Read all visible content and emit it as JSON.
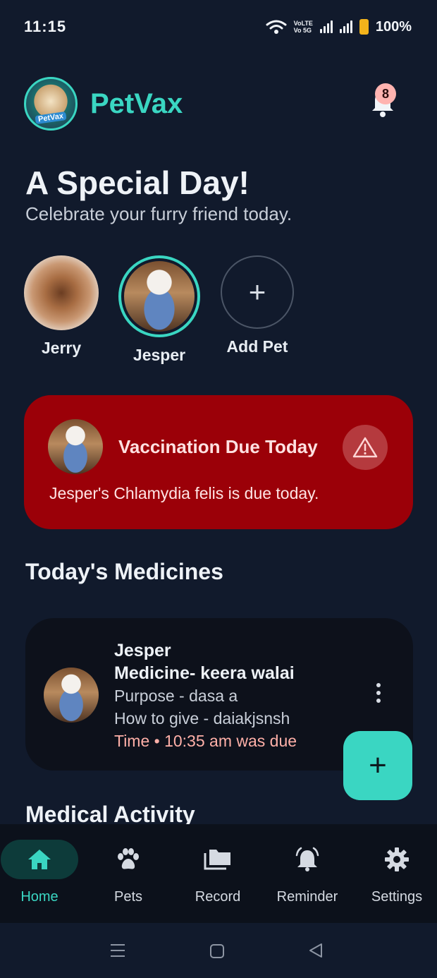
{
  "status_bar": {
    "time": "11:15",
    "volte_top": "VoLTE",
    "volte_bottom": "Vo 5G",
    "battery": "100%"
  },
  "header": {
    "app_name": "PetVax",
    "logo_text": "PetVax",
    "notification_count": "8"
  },
  "greeting": {
    "title": "A Special Day!",
    "subtitle": "Celebrate your furry friend today."
  },
  "pets": [
    {
      "name": "Jerry",
      "selected": false
    },
    {
      "name": "Jesper",
      "selected": true
    }
  ],
  "add_pet_label": "Add Pet",
  "vaccination_alert": {
    "title": "Vaccination Due Today",
    "message": "Jesper's Chlamydia felis is due today."
  },
  "medicines": {
    "section_title": "Today's Medicines",
    "item": {
      "pet": "Jesper",
      "medicine": "Medicine-  keera walai",
      "purpose": "Purpose  -  dasa a",
      "how_to_give": "How to give  -  daiakjsnsh",
      "time": "Time  •  10:35 am was due"
    }
  },
  "next_section_title": "Medical Activity",
  "fab_label": "+",
  "nav": [
    {
      "label": "Home",
      "icon": "home-icon",
      "active": true
    },
    {
      "label": "Pets",
      "icon": "paw-icon",
      "active": false
    },
    {
      "label": "Record",
      "icon": "folders-icon",
      "active": false
    },
    {
      "label": "Reminder",
      "icon": "alarm-bell-icon",
      "active": false
    },
    {
      "label": "Settings",
      "icon": "gear-icon",
      "active": false
    }
  ],
  "colors": {
    "accent": "#3ad6c2",
    "alert_bg": "#9b0008",
    "background": "#111a2c",
    "due_time": "#ffb0a8"
  }
}
